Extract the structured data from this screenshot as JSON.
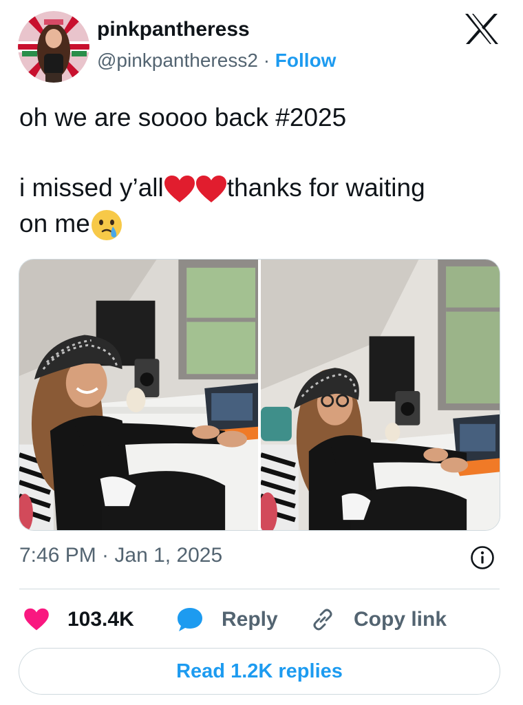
{
  "author": {
    "display_name": "pinkpantheress",
    "handle": "@pinkpantheress2",
    "separator": "·",
    "follow_label": "Follow"
  },
  "tweet": {
    "line1": "oh we are soooo back #2025",
    "line2_before": "i missed y’all",
    "line2_after": "thanks for waiting",
    "line3": "on me",
    "emojis": [
      "red-heart",
      "red-heart",
      "face-holding-back-tears"
    ]
  },
  "media": {
    "photos": [
      "photo-1",
      "photo-2"
    ]
  },
  "meta": {
    "timestamp": "7:46 PM · Jan 1, 2025"
  },
  "actions": {
    "likes_count": "103.4K",
    "reply_label": "Reply",
    "copy_link_label": "Copy link"
  },
  "read_replies_label": "Read 1.2K replies",
  "colors": {
    "accent": "#1d9bf0",
    "heart": "#f91880",
    "text": "#0f1419",
    "muted": "#536471"
  }
}
